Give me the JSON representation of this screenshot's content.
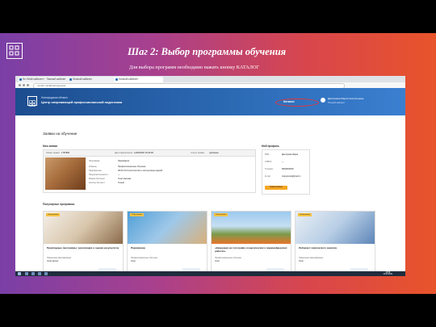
{
  "slide": {
    "title": "Шаг 2: Выбор программы обучения",
    "subtitle": "Для выбора программ необходимо нажать кнопку КАТАЛОГ"
  },
  "browser": {
    "tabs": [
      "Лк «Мой кабинет» · Личный кабинет",
      "Личный кабинет",
      "Личный кабинет"
    ],
    "url": "novobr.ru/cabinet/requests"
  },
  "site": {
    "region": "Новгородская область",
    "center": "Центр опережающей профессиональной подготовки",
    "catalog_label": "Каталог",
    "user_name": "Дмитриева Мария Анатольевна",
    "user_role": "Личный кабинет"
  },
  "page": {
    "title": "Заявки на обучение",
    "my_requests": "Мои заявки",
    "my_profile": "Мой профиль",
    "popular": "Популярные программы",
    "request": {
      "number_label": "Номер заявки:",
      "number": "1787896",
      "date_label": "Дата оформления:",
      "date": "12/05/2020 15:29:09",
      "status_label": "Статус заявки:",
      "status": "одобрена",
      "details": [
        {
          "label": "Программа:",
          "value": "Парикмахер"
        },
        {
          "label": "Уровень:",
          "value": "Профессиональное обучение"
        },
        {
          "label": "Направление:",
          "value": "08.02.01 Строительство и эксплуатация зданий"
        },
        {
          "label": "Продолжительность:",
          "value": "—"
        },
        {
          "label": "Форма обучения:",
          "value": "Очно-заочная"
        },
        {
          "label": "Количество мест:",
          "value": "Очный"
        }
      ]
    },
    "profile": {
      "rows": [
        {
          "label": "ФИО",
          "value": "Дмитриева Мария"
        },
        {
          "label": "СНИЛС",
          "value": "—"
        },
        {
          "label": "Телефон",
          "value": "89000000000"
        },
        {
          "label": "E-mail",
          "value": "mapyanova@gmail.ru"
        }
      ],
      "edit_label": "Редактировать"
    },
    "programs": [
      {
        "badge": "Очно-заочно",
        "title": "Прикладные программы: реализация и оценка результатов",
        "desc": "Повышение квалификации",
        "form": "Очно-заочно"
      },
      {
        "badge": "Очно-заочно",
        "title": "Парикмахер",
        "desc": "Профессиональное обучение",
        "form": "Очно"
      },
      {
        "badge": "Очно-заочно",
        "title": "«Замерщик на топографо-геодезических и маркшейдерских работах»",
        "desc": "Профессиональное обучение",
        "form": "Очно"
      },
      {
        "badge": "Очно-заочно",
        "title": "Лаборант химического анализа",
        "desc": "Повышение квалификации",
        "form": "Очно"
      }
    ]
  },
  "taskbar": {
    "time": "13:58",
    "date": "12.05.2020"
  },
  "colors": {
    "header_blue": "#2d6cb7",
    "accent_orange": "#f5a623",
    "highlight_red": "#e33333"
  }
}
